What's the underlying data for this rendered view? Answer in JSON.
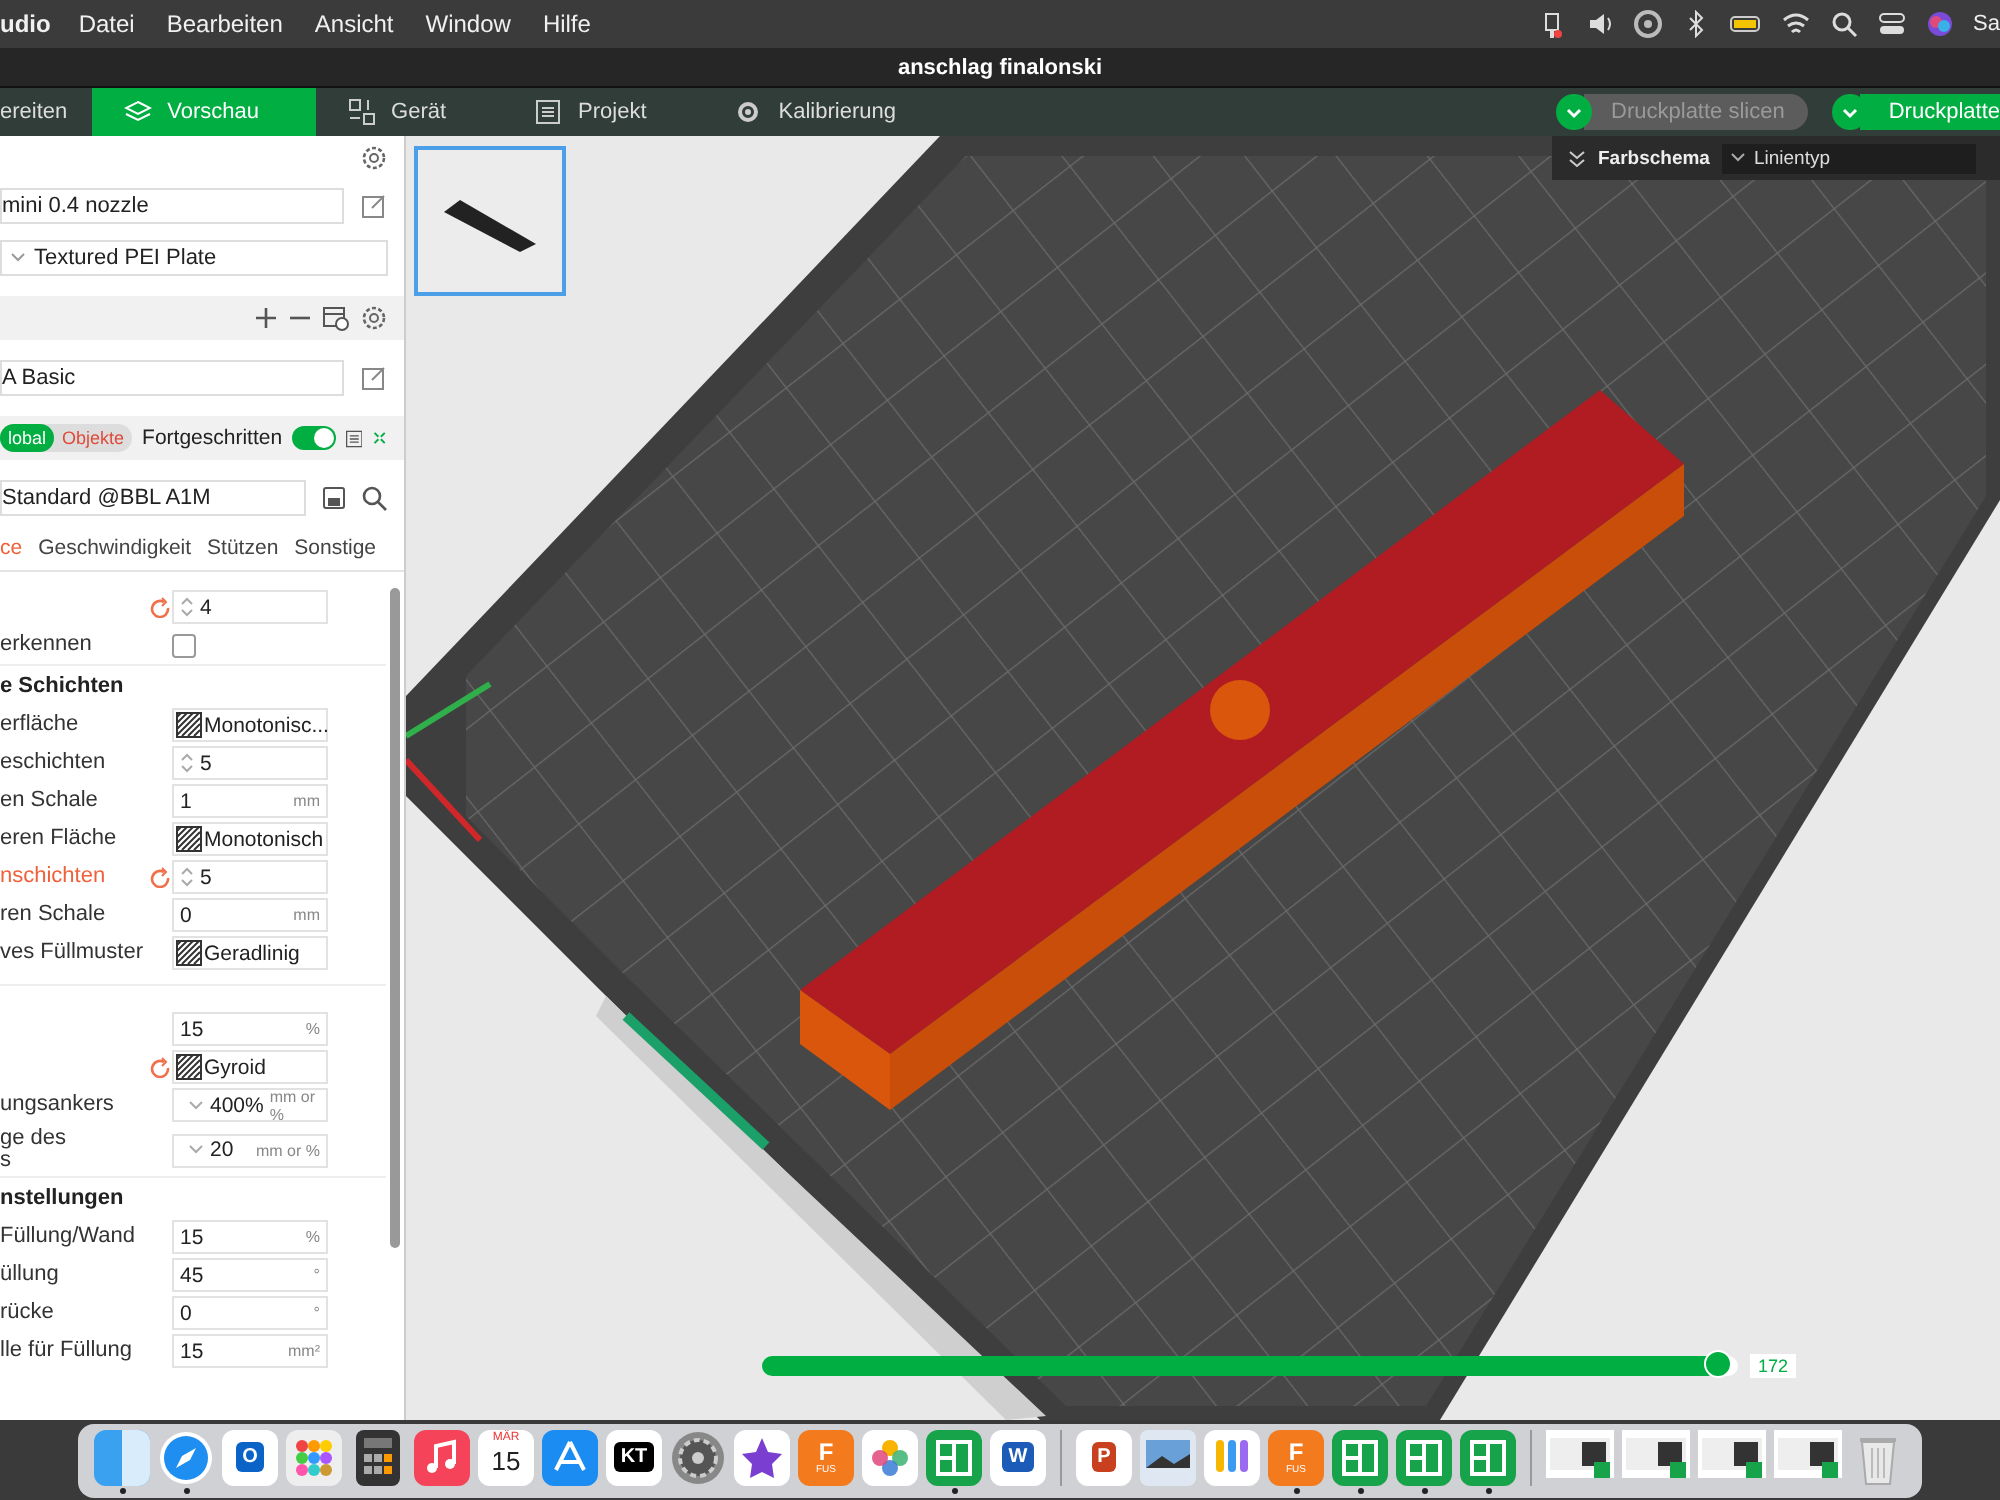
{
  "menu_bar": {
    "app_name": "udio",
    "menus": [
      "Datei",
      "Bearbeiten",
      "Ansicht",
      "Window",
      "Hilfe"
    ],
    "user": "Sa"
  },
  "window": {
    "title": "anschlag finalonski"
  },
  "toolbar": {
    "tabs": [
      {
        "label": "ereiten",
        "selected": false
      },
      {
        "label": "Vorschau",
        "selected": true
      },
      {
        "label": "Gerät",
        "selected": false
      },
      {
        "label": "Projekt",
        "selected": false
      },
      {
        "label": "Kalibrierung",
        "selected": false
      }
    ],
    "slice_buttons": [
      {
        "label": "Druckplatte slicen",
        "disabled": true
      },
      {
        "label": "Druckplatte",
        "disabled": false
      }
    ]
  },
  "printer": {
    "nozzle": "mini 0.4 nozzle",
    "plate": "Textured PEI Plate"
  },
  "filament": {
    "name": "A Basic"
  },
  "process": {
    "scope": [
      {
        "label": "lobal",
        "selected": true
      },
      {
        "label": "Objekte",
        "selected": false
      }
    ],
    "advanced": {
      "label": "Fortgeschritten",
      "on": true
    },
    "preset": "Standard @BBL A1M",
    "tabs": [
      {
        "label": "ce",
        "selected": true
      },
      {
        "label": "Geschwindigkeit",
        "selected": false
      },
      {
        "label": "Stützen",
        "selected": false
      },
      {
        "label": "Sonstige",
        "selected": false
      }
    ]
  },
  "settings": [
    {
      "kind": "spinner",
      "value": "4",
      "modified": true
    },
    {
      "kind": "checkbox",
      "label": "erkennen",
      "checked": false
    },
    {
      "kind": "section",
      "label": "e Schichten"
    },
    {
      "kind": "pattern",
      "label": "erfläche",
      "value": "Monotonisc...",
      "modified": false
    },
    {
      "kind": "spinner",
      "label": "eschichten",
      "value": "5",
      "modified": false
    },
    {
      "kind": "number",
      "label": "en Schale",
      "value": "1",
      "unit": "mm",
      "modified": false
    },
    {
      "kind": "pattern",
      "label": "eren Fläche",
      "value": "Monotonisch",
      "modified": false
    },
    {
      "kind": "spinner",
      "label": "nschichten",
      "value": "5",
      "modified": true
    },
    {
      "kind": "number",
      "label": "ren Schale",
      "value": "0",
      "unit": "mm",
      "modified": false
    },
    {
      "kind": "pattern",
      "label": "ves Füllmuster",
      "value": "Geradlinig",
      "modified": false
    },
    {
      "kind": "divider"
    },
    {
      "kind": "number",
      "value": "15",
      "unit": "%",
      "modified": false
    },
    {
      "kind": "pattern",
      "value": "Gyroid",
      "modified": true
    },
    {
      "kind": "dropdown",
      "label": "ungsankers",
      "value": "400%",
      "unit": "mm or %",
      "modified": false
    },
    {
      "kind": "dropdown",
      "label": "ge des\ns",
      "value": "20",
      "unit": "mm or %",
      "modified": false
    },
    {
      "kind": "section",
      "label": "nstellungen"
    },
    {
      "kind": "number",
      "label": "Füllung/Wand",
      "value": "15",
      "unit": "%",
      "modified": false
    },
    {
      "kind": "number",
      "label": "üllung",
      "value": "45",
      "unit": "°",
      "modified": false
    },
    {
      "kind": "number",
      "label": "rücke",
      "value": "0",
      "unit": "°",
      "modified": false
    },
    {
      "kind": "number",
      "label": "lle für Füllung",
      "value": "15",
      "unit": "mm²",
      "modified": false
    }
  ],
  "viewport": {
    "plates": [
      {
        "selected": true
      }
    ],
    "color_scheme": {
      "label": "Farbschema",
      "value": "Linientyp"
    },
    "layer_slider": {
      "level": 0.98,
      "reading": "172"
    }
  },
  "dock": [
    {
      "kind": "finder",
      "running": true
    },
    {
      "kind": "safari",
      "running": true
    },
    {
      "kind": "letter",
      "glyph": "O",
      "color": "#0a64c8",
      "running": false
    },
    {
      "kind": "launchpad",
      "running": false
    },
    {
      "kind": "calculator",
      "running": false
    },
    {
      "kind": "music",
      "running": false
    },
    {
      "kind": "calendar",
      "month": "MÄR",
      "day": "15",
      "running": false
    },
    {
      "kind": "appstore",
      "running": false
    },
    {
      "kind": "letter",
      "glyph": "KT",
      "color": "#000000",
      "running": false
    },
    {
      "kind": "settings",
      "running": false
    },
    {
      "kind": "star",
      "running": false
    },
    {
      "kind": "fusion",
      "glyph": "F",
      "sub": "FUS",
      "running": false
    },
    {
      "kind": "photos",
      "running": false
    },
    {
      "kind": "green",
      "running": true
    },
    {
      "kind": "letter",
      "glyph": "W",
      "color": "#1c5bb8",
      "running": false
    },
    {
      "kind": "separator"
    },
    {
      "kind": "letter",
      "glyph": "P",
      "color": "#c8401e",
      "running": false
    },
    {
      "kind": "preview",
      "running": false
    },
    {
      "kind": "keys",
      "running": false
    },
    {
      "kind": "fusion",
      "glyph": "F",
      "sub": "FUS",
      "running": true
    },
    {
      "kind": "green",
      "running": true
    },
    {
      "kind": "green",
      "running": true
    },
    {
      "kind": "green",
      "running": true
    },
    {
      "kind": "separator"
    },
    {
      "kind": "window"
    },
    {
      "kind": "window"
    },
    {
      "kind": "window"
    },
    {
      "kind": "window"
    },
    {
      "kind": "trash"
    }
  ]
}
